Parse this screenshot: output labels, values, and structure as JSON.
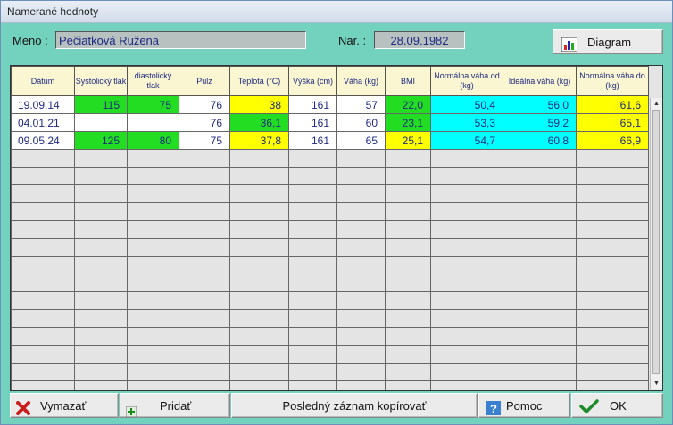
{
  "window": {
    "title": "Namerané hodnoty"
  },
  "patient": {
    "name_label": "Meno :",
    "name": "Pečiatková Ružena",
    "dob_label": "Nar. :",
    "dob": "28.09.1982"
  },
  "toolbar": {
    "diagram_label": "Diagram"
  },
  "table": {
    "columns": [
      "Dátum",
      "Systolický tlak",
      "diastolický tlak",
      "Pulz",
      "Teplota (°C)",
      "Výška (cm)",
      "Váha (kg)",
      "BMI",
      "Normálna váha od (kg)",
      "Ideálna váha (kg)",
      "Normálna váha do (kg)"
    ],
    "rows": [
      [
        "19.09.14",
        "115",
        "75",
        "76",
        "38",
        "161",
        "57",
        "22,0",
        "50,4",
        "56,0",
        "61,6"
      ],
      [
        "04.01.21",
        "",
        "",
        "76",
        "36,1",
        "161",
        "60",
        "23,1",
        "53,3",
        "59,2",
        "65,1"
      ],
      [
        "09.05.24",
        "125",
        "80",
        "75",
        "37,8",
        "161",
        "65",
        "25,1",
        "54,7",
        "60,8",
        "66,9"
      ]
    ],
    "row_colors": [
      [
        "#ffffff",
        "#22dd22",
        "#22dd22",
        "#ffffff",
        "#ffff00",
        "#ffffff",
        "#ffffff",
        "#22dd22",
        "#00ffff",
        "#00ffff",
        "#ffff00"
      ],
      [
        "#ffffff",
        "#ffffff",
        "#ffffff",
        "#ffffff",
        "#22dd22",
        "#ffffff",
        "#ffffff",
        "#22dd22",
        "#00ffff",
        "#00ffff",
        "#ffff00"
      ],
      [
        "#ffffff",
        "#22dd22",
        "#22dd22",
        "#ffffff",
        "#ffff00",
        "#ffffff",
        "#ffffff",
        "#ffff00",
        "#00ffff",
        "#00ffff",
        "#ffff00"
      ]
    ],
    "empty_row_color": "#e4e4e4",
    "header_color": "#faf6d2"
  },
  "buttons": {
    "delete_label": "Vymazať",
    "add_label": "Pridať",
    "copy_last_label": "Posledný záznam kopírovať",
    "help_label": "Pomoc",
    "ok_label": "OK"
  },
  "colors": {
    "window_bg": "#73d2bd",
    "field_bg": "#b8c0c0",
    "text_blue": "#1e2a80"
  }
}
